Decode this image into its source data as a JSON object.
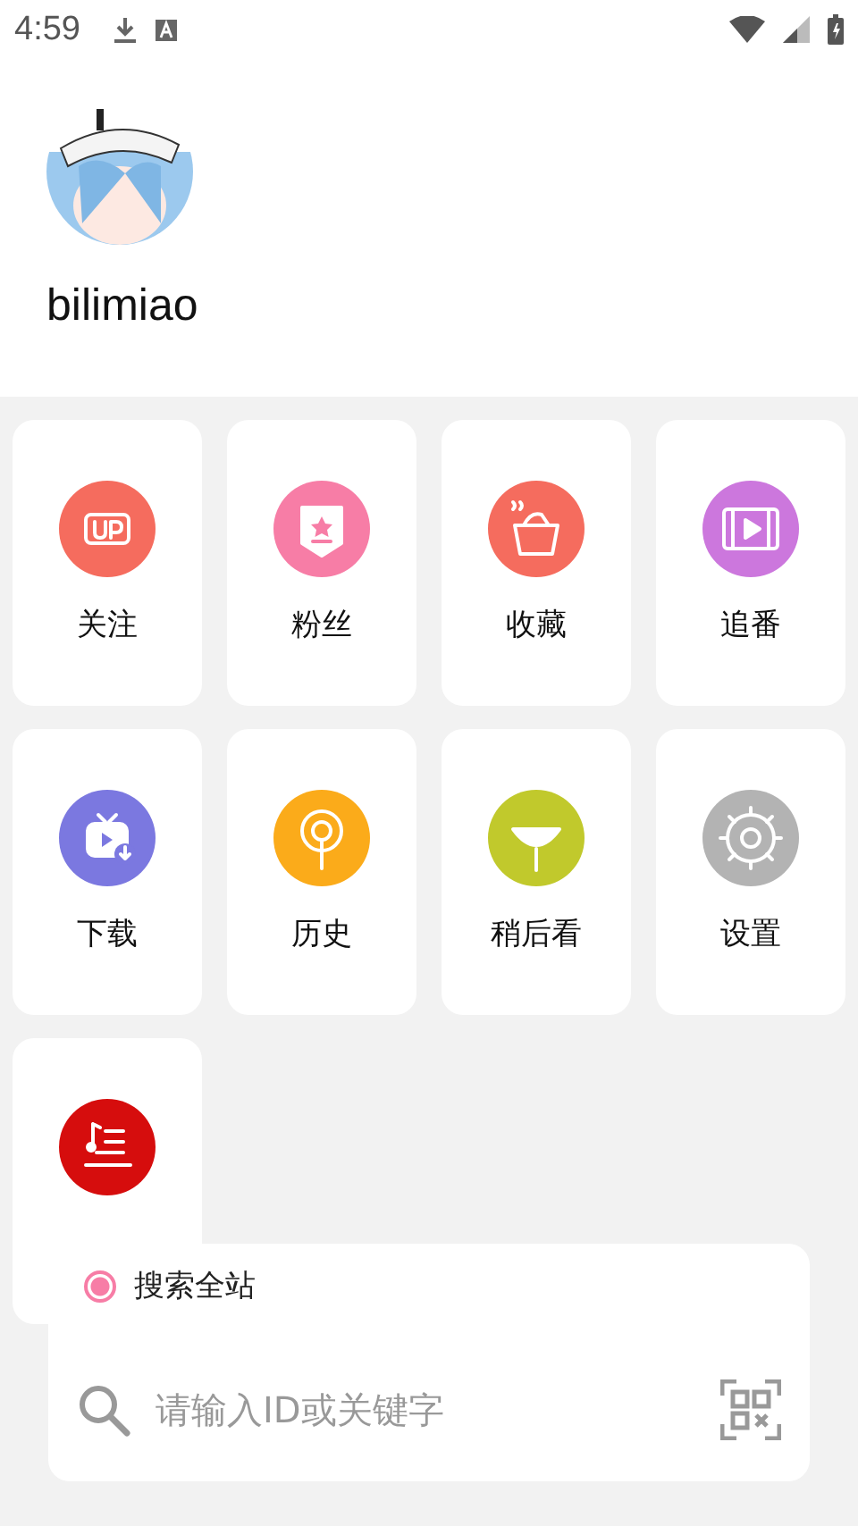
{
  "status_bar": {
    "time": "4:59"
  },
  "profile": {
    "name": "bilimiao"
  },
  "menu": [
    {
      "label": "关注",
      "kind": "up",
      "color": "#f56c5e"
    },
    {
      "label": "粉丝",
      "kind": "badge",
      "color": "#f77da6"
    },
    {
      "label": "收藏",
      "kind": "pot",
      "color": "#f56c5e"
    },
    {
      "label": "追番",
      "kind": "film",
      "color": "#cc77dd"
    },
    {
      "label": "下载",
      "kind": "tv",
      "color": "#7b78e0"
    },
    {
      "label": "历史",
      "kind": "signal",
      "color": "#fbab1a"
    },
    {
      "label": "稍后看",
      "kind": "melon",
      "color": "#c1c92c"
    },
    {
      "label": "设置",
      "kind": "gear",
      "color": "#b3b3b3"
    },
    {
      "kind": "lyrics",
      "color": "#d60d0d"
    }
  ],
  "search": {
    "scope": {
      "label": "搜索全站",
      "selected": true
    },
    "placeholder": "请输入ID或关键字"
  }
}
